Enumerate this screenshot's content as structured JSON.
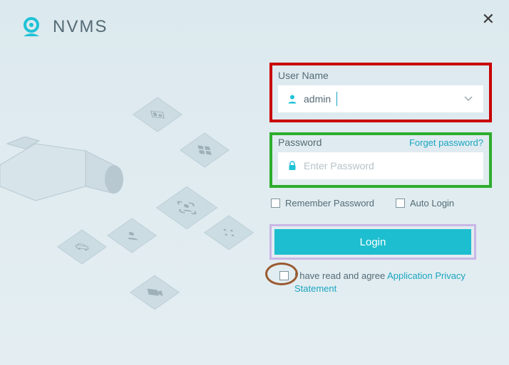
{
  "brand": "NVMS",
  "form": {
    "username_label": "User Name",
    "username_value": "admin",
    "password_label": "Password",
    "forget_link": "Forget password?",
    "password_placeholder": "Enter Password",
    "remember_label": "Remember Password",
    "autologin_label": "Auto Login",
    "login_button": "Login",
    "agree_prefix": "I have read and agree ",
    "agree_link": "Application Privacy Statement"
  },
  "icons": {
    "logo": "camera-logo-icon",
    "close": "✕",
    "user": "person-icon",
    "lock": "lock-icon",
    "chevron": "chevron-down-icon"
  }
}
